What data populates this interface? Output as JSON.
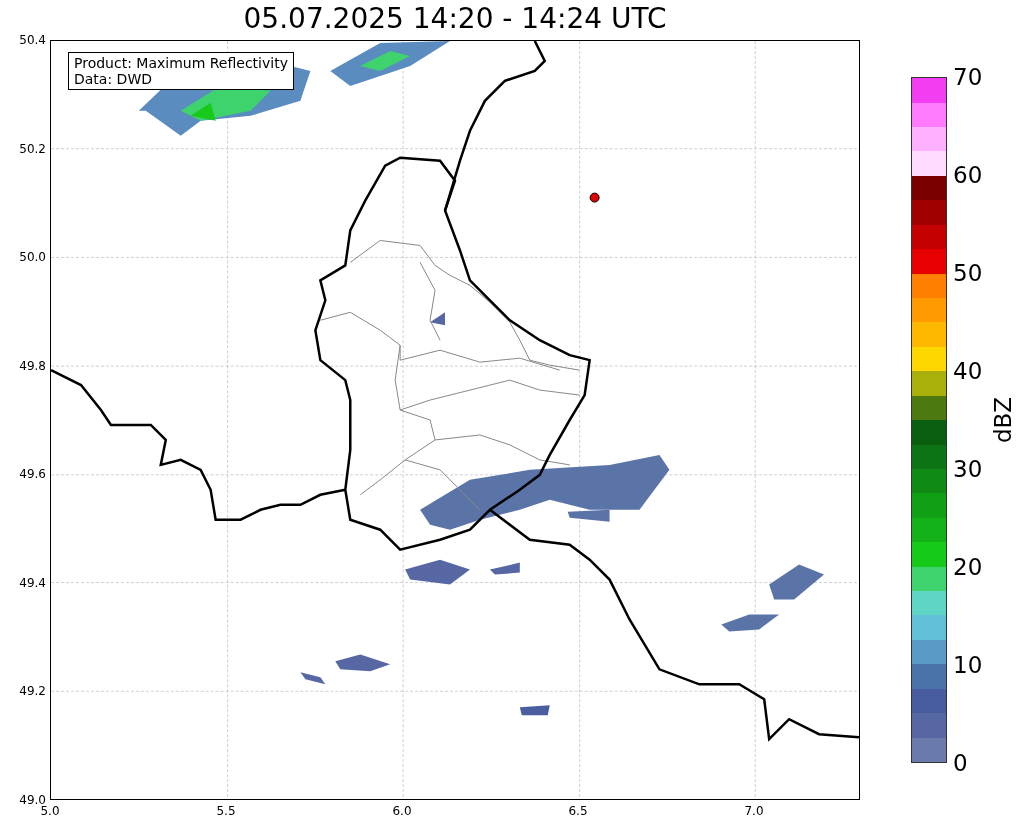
{
  "title": "05.07.2025 14:20 - 14:24 UTC",
  "annotation": [
    "Product: Maximum Reflectivity",
    "Data: DWD"
  ],
  "x_axis": {
    "ticks": [
      "5.0",
      "5.5",
      "6.0",
      "6.5",
      "7.0"
    ]
  },
  "y_axis": {
    "ticks": [
      "50.4",
      "50.2",
      "50.0",
      "49.8",
      "49.6",
      "49.4",
      "49.2",
      "49.0"
    ]
  },
  "colorbar": {
    "label": "dBZ",
    "ticks": [
      "70",
      "60",
      "50",
      "40",
      "30",
      "20",
      "10",
      "0"
    ],
    "segments": [
      {
        "color": "#6a7bab"
      },
      {
        "color": "#5767a3"
      },
      {
        "color": "#465c9f"
      },
      {
        "color": "#4a73ac"
      },
      {
        "color": "#5a9bc8"
      },
      {
        "color": "#62bfd8"
      },
      {
        "color": "#5fd6c5"
      },
      {
        "color": "#3fd36e"
      },
      {
        "color": "#17c919"
      },
      {
        "color": "#12b218"
      },
      {
        "color": "#10a016"
      },
      {
        "color": "#0e8a15"
      },
      {
        "color": "#0c7414"
      },
      {
        "color": "#0a5e10"
      },
      {
        "color": "#4c7a10"
      },
      {
        "color": "#aab00a"
      },
      {
        "color": "#ffd700"
      },
      {
        "color": "#ffb800"
      },
      {
        "color": "#ff9a00"
      },
      {
        "color": "#ff7f00"
      },
      {
        "color": "#e60000"
      },
      {
        "color": "#c40000"
      },
      {
        "color": "#a00000"
      },
      {
        "color": "#7a0000"
      },
      {
        "color": "#ffdcff"
      },
      {
        "color": "#ffb0ff"
      },
      {
        "color": "#ff7aff"
      },
      {
        "color": "#f03ef0"
      }
    ]
  }
}
